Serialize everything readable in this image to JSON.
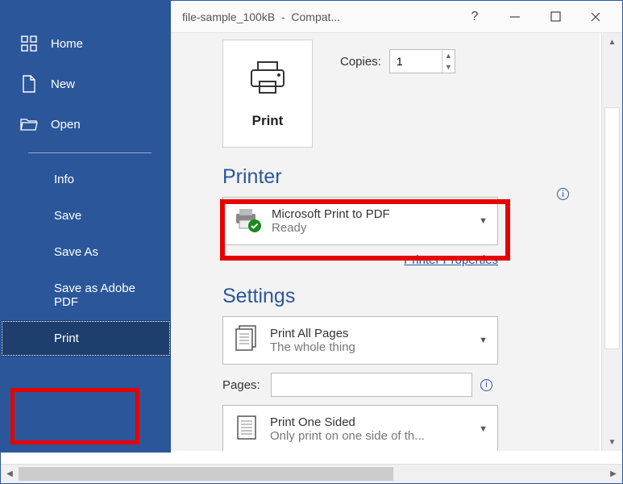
{
  "titlebar": {
    "filename": "file-sample_100kB",
    "mode": "Compat..."
  },
  "sidebar": {
    "home": "Home",
    "new": "New",
    "open": "Open",
    "info": "Info",
    "save": "Save",
    "saveas": "Save As",
    "saveadobe": "Save as Adobe PDF",
    "print": "Print"
  },
  "print": {
    "button": "Print",
    "copies_label": "Copies:",
    "copies_value": "1",
    "printer_heading": "Printer",
    "printer_name": "Microsoft Print to PDF",
    "printer_status": "Ready",
    "printer_props": "Printer Properties",
    "settings_heading": "Settings",
    "print_all": "Print All Pages",
    "print_all_sub": "The whole thing",
    "pages_label": "Pages:",
    "pages_value": "",
    "one_sided": "Print One Sided",
    "one_sided_sub": "Only print on one side of th..."
  }
}
